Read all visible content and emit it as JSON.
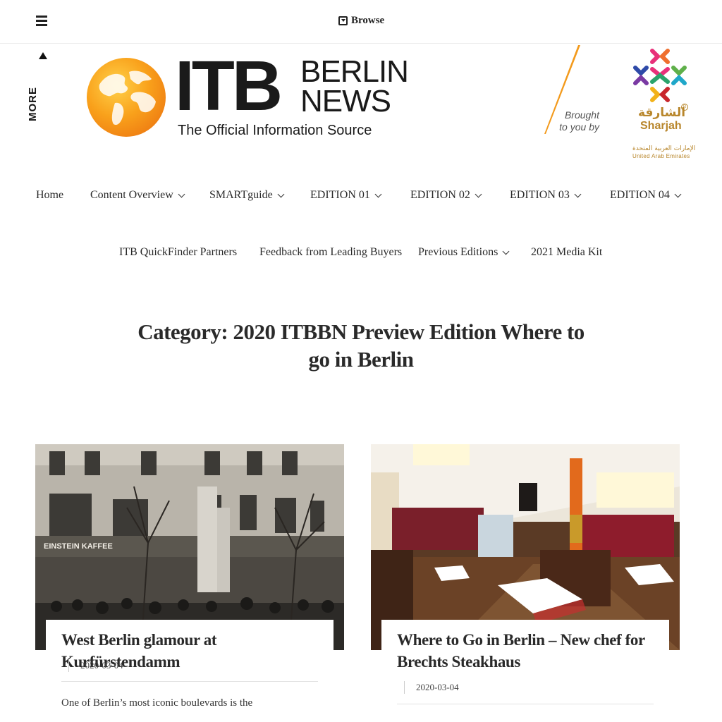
{
  "topbar": {
    "menu_icon": "hamburger-icon",
    "browse_icon": "browse-icon",
    "browse_label": "Browse"
  },
  "sidebar": {
    "more_label": "MORE",
    "more_icon": "triangle-up-icon"
  },
  "logo": {
    "itb": "ITB",
    "berlin": "BERLIN",
    "news": "NEWS",
    "tagline": "The Official Information Source"
  },
  "sponsor": {
    "brought_line1": "Brought",
    "brought_line2": "to you by",
    "name_ar": "الشارقة",
    "name_en": "Sharjah",
    "country_ar": "الإمارات العربية المتحدة",
    "country_en": "United  Arab  Emirates"
  },
  "nav": {
    "row1": [
      {
        "label": "Home",
        "dropdown": false
      },
      {
        "label": "Content Overview",
        "dropdown": true
      },
      {
        "label": "SMARTguide",
        "dropdown": true
      },
      {
        "label": "EDITION 01",
        "dropdown": true
      },
      {
        "label": "EDITION 02",
        "dropdown": true
      },
      {
        "label": "EDITION 03",
        "dropdown": true
      },
      {
        "label": "EDITION 04",
        "dropdown": true
      }
    ],
    "row2": [
      {
        "label": "ITB QuickFinder Partners",
        "dropdown": false
      },
      {
        "label": "Feedback from Leading Buyers",
        "dropdown": false
      },
      {
        "label": "Previous Editions",
        "dropdown": true
      },
      {
        "label": "2021 Media Kit",
        "dropdown": false
      }
    ]
  },
  "page": {
    "title": "Category: 2020 ITBBN Preview Edition Where to go in Berlin"
  },
  "posts": [
    {
      "title": "West Berlin glamour at Kurfürstendamm",
      "date": "2020-03-04",
      "excerpt": "One of Berlin’s most iconic boulevards is the",
      "sign_text": "EINSTEIN KAFFEE"
    },
    {
      "title": "Where to Go in Berlin – New chef for Brechts Steakhaus",
      "date": "2020-03-04"
    }
  ],
  "colors": {
    "accent_orange": "#f39a1c",
    "sharjah_gold": "#b8862b",
    "text": "#2a2a2a"
  }
}
